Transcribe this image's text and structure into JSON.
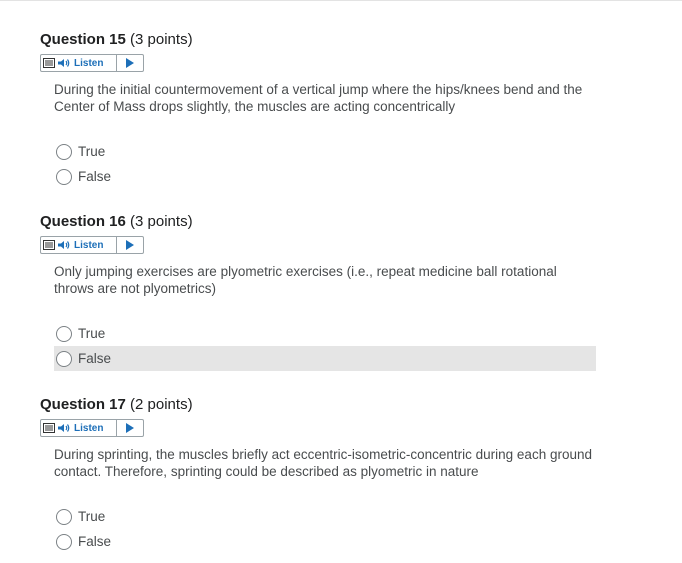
{
  "listen_label": "Listen",
  "questions": [
    {
      "number": "Question 15",
      "points": "(3 points)",
      "text": "During the initial countermovement of a vertical jump where the hips/knees bend and the Center of Mass drops slightly, the muscles are acting concentrically",
      "options": [
        "True",
        "False"
      ]
    },
    {
      "number": "Question 16",
      "points": "(3 points)",
      "text": "Only jumping exercises are plyometric exercises (i.e., repeat medicine ball rotational throws are not plyometrics)",
      "options": [
        "True",
        "False"
      ]
    },
    {
      "number": "Question 17",
      "points": "(2 points)",
      "text": "During sprinting, the muscles briefly act eccentric-isometric-concentric during each ground contact. Therefore, sprinting could be described as plyometric in nature",
      "options": [
        "True",
        "False"
      ]
    }
  ],
  "colors": {
    "listen_link": "#1d6fb8",
    "hover_row": "#e5e5e5",
    "title": "#202122",
    "body_text": "#494c4e"
  }
}
